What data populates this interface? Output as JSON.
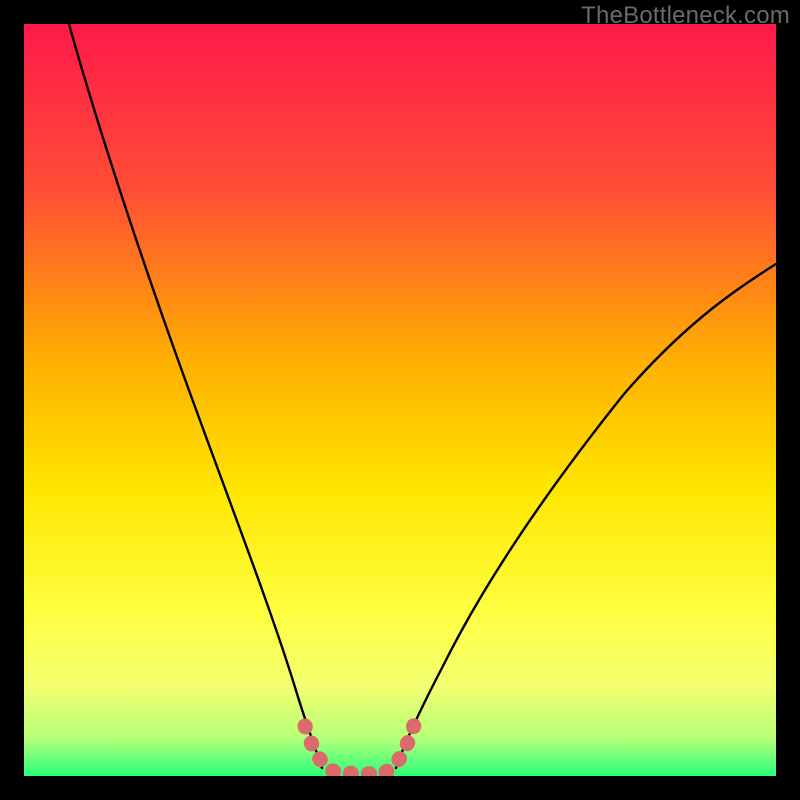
{
  "watermark": "TheBottleneck.com",
  "chart_data": {
    "type": "line",
    "title": "",
    "xlabel": "",
    "ylabel": "",
    "xlim": [
      0,
      100
    ],
    "ylim": [
      0,
      100
    ],
    "grid": false,
    "legend": false,
    "background_gradient": [
      "#ff1a4a",
      "#ff6a2a",
      "#ffc400",
      "#ffff3a",
      "#e8ff6a",
      "#2aff7a"
    ],
    "series": [
      {
        "name": "bottleneck-curve-left",
        "color": "#000000",
        "x": [
          6,
          8,
          10,
          12,
          15,
          18,
          21,
          24,
          27,
          30,
          32,
          34,
          36,
          38,
          39.5
        ],
        "y": [
          100,
          93,
          86,
          78,
          68,
          58,
          49,
          40,
          31,
          23,
          17,
          12,
          7,
          3,
          1
        ]
      },
      {
        "name": "bottleneck-curve-right",
        "color": "#000000",
        "x": [
          49.5,
          51,
          53,
          56,
          60,
          65,
          71,
          78,
          86,
          95,
          100
        ],
        "y": [
          1,
          3,
          6,
          11,
          18,
          26,
          35,
          44,
          54,
          63,
          68
        ]
      },
      {
        "name": "highlight-band",
        "color": "#e06666",
        "note": "thick dotted U segment at minimum",
        "x": [
          37,
          38,
          39,
          40,
          41,
          42,
          43,
          44,
          45,
          46,
          47,
          48,
          49,
          50,
          51,
          52
        ],
        "y": [
          6,
          3.5,
          2,
          1,
          0.5,
          0.3,
          0.2,
          0.2,
          0.2,
          0.3,
          0.5,
          1,
          2,
          3.5,
          5.5,
          8
        ]
      }
    ],
    "minimum_location_pct": 44.5
  }
}
